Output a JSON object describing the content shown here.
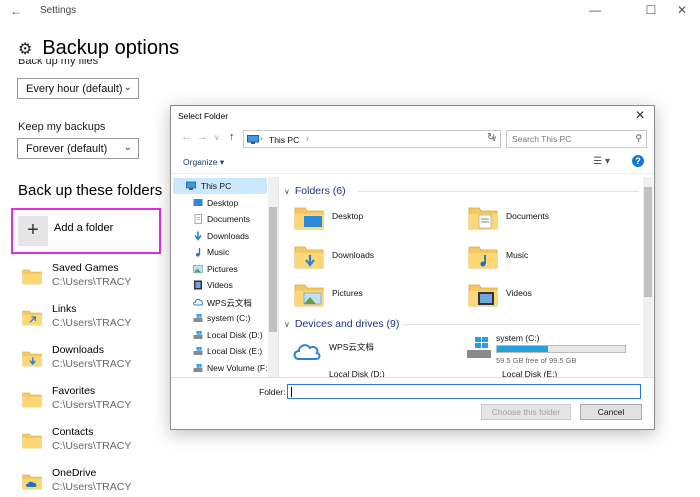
{
  "settings": {
    "window_title": "Settings",
    "page_title": "Backup options",
    "backup_frequency_label": "Back up my files",
    "backup_frequency_value": "Every hour (default)",
    "keep_backups_label": "Keep my backups",
    "keep_backups_value": "Forever (default)",
    "section_title": "Back up these folders",
    "add_folder_label": "Add a folder",
    "folders": [
      {
        "name": "Saved Games",
        "path": "C:\\Users\\TRACY"
      },
      {
        "name": "Links",
        "path": "C:\\Users\\TRACY"
      },
      {
        "name": "Downloads",
        "path": "C:\\Users\\TRACY"
      },
      {
        "name": "Favorites",
        "path": "C:\\Users\\TRACY"
      },
      {
        "name": "Contacts",
        "path": "C:\\Users\\TRACY"
      },
      {
        "name": "OneDrive",
        "path": "C:\\Users\\TRACY"
      }
    ]
  },
  "dialog": {
    "title": "Select Folder",
    "address": "This PC",
    "search_placeholder": "Search This PC",
    "organize_label": "Organize",
    "nav_items": [
      {
        "label": "This PC",
        "icon": "computer-icon"
      },
      {
        "label": "Desktop",
        "icon": "desktop-icon"
      },
      {
        "label": "Documents",
        "icon": "documents-icon"
      },
      {
        "label": "Downloads",
        "icon": "downloads-icon"
      },
      {
        "label": "Music",
        "icon": "music-icon"
      },
      {
        "label": "Pictures",
        "icon": "pictures-icon"
      },
      {
        "label": "Videos",
        "icon": "videos-icon"
      },
      {
        "label": "WPS云文档",
        "icon": "cloud-icon"
      },
      {
        "label": "system (C:)",
        "icon": "drive-icon"
      },
      {
        "label": "Local Disk (D:)",
        "icon": "drive-icon"
      },
      {
        "label": "Local Disk (E:)",
        "icon": "drive-icon"
      },
      {
        "label": "New Volume (F:)",
        "icon": "drive-icon"
      }
    ],
    "folders_group": "Folders (6)",
    "folders": [
      "Desktop",
      "Documents",
      "Downloads",
      "Music",
      "Pictures",
      "Videos"
    ],
    "devices_group": "Devices and drives (9)",
    "devices": {
      "wps": "WPS云文档",
      "system_name": "system (C:)",
      "system_free": "59.5 GB free of 99.5 GB",
      "system_used_fraction": 0.4,
      "d": "Local Disk (D:)",
      "e": "Local Disk (E:)"
    },
    "folder_field_label": "Folder:",
    "folder_field_value": "",
    "choose_button": "Choose this folder",
    "cancel_button": "Cancel"
  }
}
